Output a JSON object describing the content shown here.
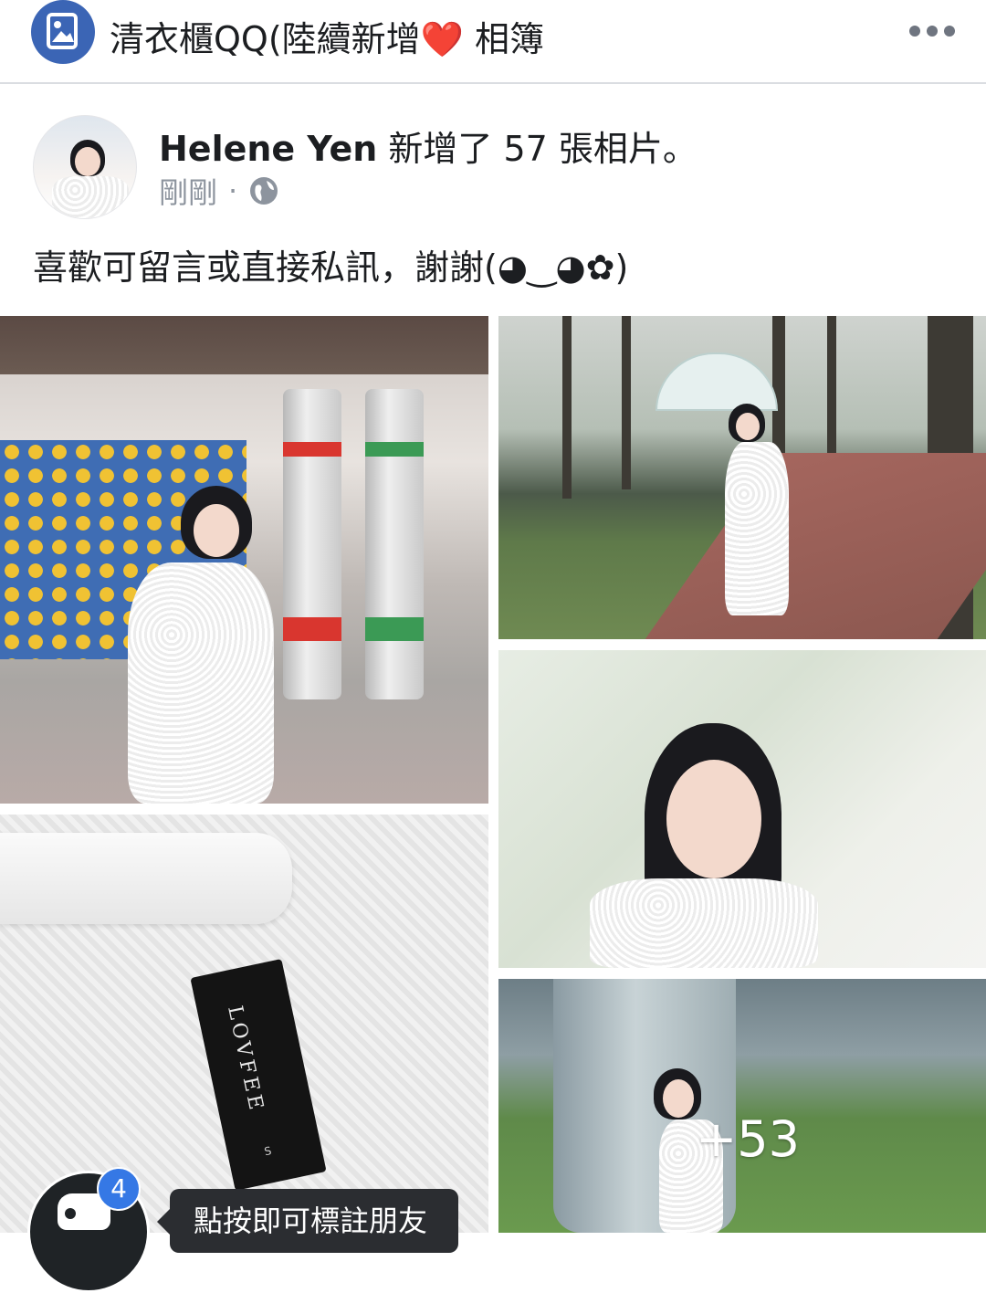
{
  "header": {
    "album_title": "清衣櫃QQ(陸續新增❤️ 相簿",
    "album_icon": "photo-album-icon",
    "more_icon": "more-dots-icon"
  },
  "post": {
    "poster_name": "Helene Yen",
    "action_text": " 新增了 57 張相片。",
    "timestamp": "剛剛",
    "separator": "·",
    "privacy_icon": "globe-icon",
    "caption": "喜歡可留言或直接私訊，謝謝(◕‿◕✿)"
  },
  "photos": {
    "more_count": "+53",
    "tag_label_brand": "LOVFEE",
    "tag_label_size": "S"
  },
  "tag_prompt": {
    "badge_count": "4",
    "text": "點按即可標註朋友"
  },
  "colors": {
    "accent": "#3b65b5",
    "badge": "#3578e5",
    "secondary_text": "#8d949e"
  }
}
